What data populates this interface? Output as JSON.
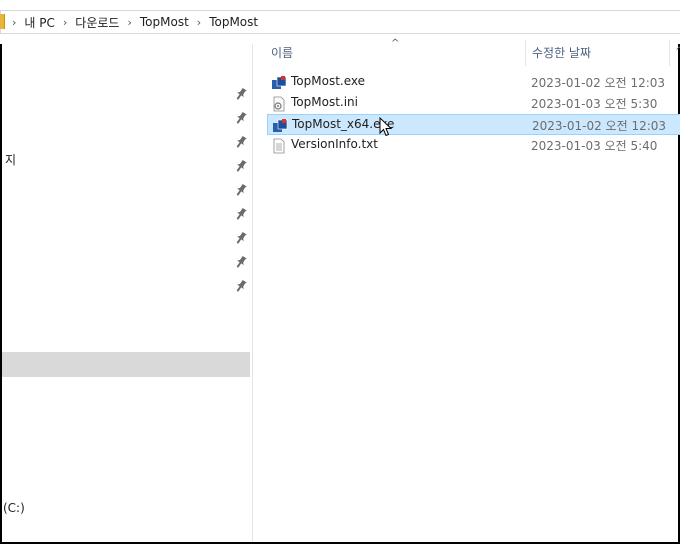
{
  "breadcrumb": {
    "items": [
      "내 PC",
      "다운로드",
      "TopMost",
      "TopMost"
    ]
  },
  "nav": {
    "partial_label_1": "지",
    "partial_label_2": "(C:)",
    "pinned_count": 9
  },
  "columns": {
    "name": "이름",
    "date_modified": "수정한 날짜"
  },
  "files": [
    {
      "name": "TopMost.exe",
      "date": "2023-01-02 오전 12:03",
      "icon": "app-icon"
    },
    {
      "name": "TopMost.ini",
      "date": "2023-01-03 오전 5:30",
      "icon": "settings-file-icon"
    },
    {
      "name": "TopMost_x64.exe",
      "date": "2023-01-02 오전 12:03",
      "icon": "app-icon",
      "selected": true
    },
    {
      "name": "VersionInfo.txt",
      "date": "2023-01-03 오전 5:40",
      "icon": "text-file-icon"
    }
  ],
  "colors": {
    "selection_bg": "#cce8ff",
    "selection_border": "#99d1ff",
    "nav_selected": "#d9d9d9",
    "header_text": "#4d6082"
  }
}
